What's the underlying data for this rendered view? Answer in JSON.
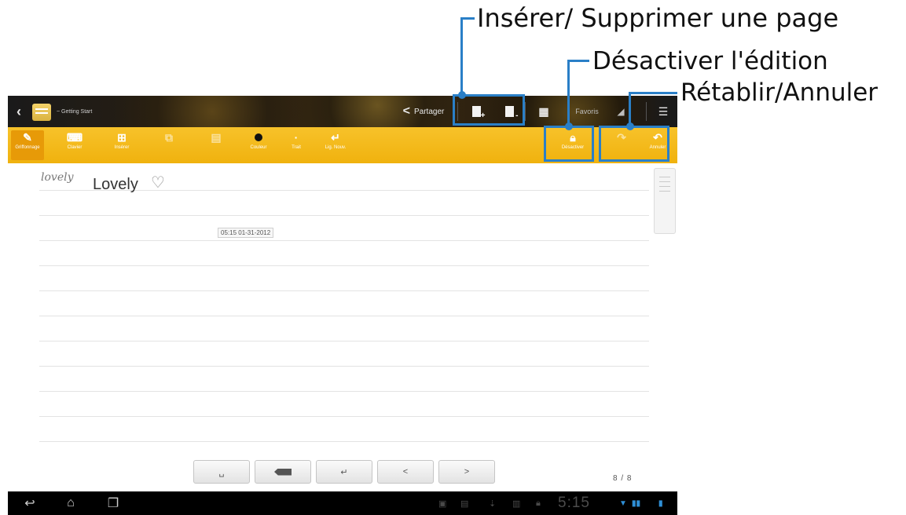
{
  "titlebar": {
    "notebook_title": "~ Getting Start",
    "share_label": "Partager",
    "favorites_label": "Favoris"
  },
  "toolbar": {
    "tools": [
      {
        "label": "Griffonnage",
        "icon": "scribble-icon"
      },
      {
        "label": "Clavier",
        "icon": "keyboard-icon"
      },
      {
        "label": "Insérer",
        "icon": "insert-icon"
      },
      {
        "label": "",
        "icon": "copy-icon"
      },
      {
        "label": "",
        "icon": "paste-icon"
      },
      {
        "label": "Couleur",
        "icon": "color-dot-icon"
      },
      {
        "label": "Trait",
        "icon": "stroke-icon"
      },
      {
        "label": "Lig. Nouv.",
        "icon": "new-line-icon"
      }
    ],
    "edit_lock_label": "Désactiver",
    "undo_label": "",
    "redo_label": "Annuler"
  },
  "note": {
    "handwriting": "lovely",
    "typed_text": "Lovely",
    "heart_glyph": "♡",
    "timestamp": "05:15 01-31-2012"
  },
  "keyboard_row": {
    "space": "␣",
    "enter": "↵",
    "prev": "<",
    "next": ">"
  },
  "page_counter": "8 / 8",
  "statusbar": {
    "time": "5:15"
  },
  "callouts": {
    "insert_delete": "Insérer/ Supprimer une page",
    "disable_edit": "Désactiver l'édition",
    "undo_redo": "Rétablir/Annuler"
  },
  "colors": {
    "toolbar": "#f2b716",
    "callout": "#2a7fc7"
  }
}
